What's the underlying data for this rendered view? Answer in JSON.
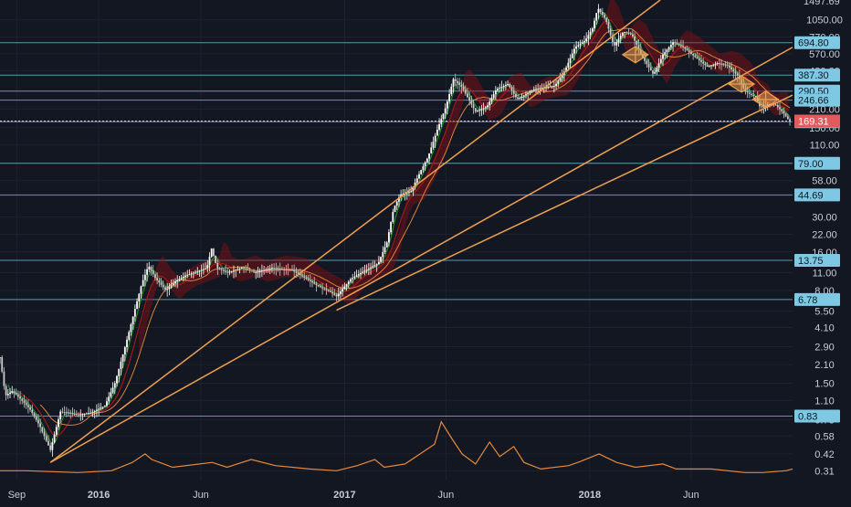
{
  "chart_data": {
    "type": "line",
    "scale": "log",
    "grid": true,
    "theme": {
      "background": "#131722",
      "grid": "#1e2230",
      "axis_text": "#c8ccd6",
      "level_line": "#5fb3c8",
      "trend": "#f0a050",
      "candle_up": "#ffffff",
      "candle_down": "#c9c9c9",
      "cloud": "#8b0f14",
      "ma_green": "#1f8a1f",
      "ma_red": "#a31717",
      "ma_orange": "#d8823a",
      "volume_line": "#e8893a",
      "last_price_bg": "#e05c5c",
      "label_bg": "#7ec8e3"
    },
    "y_ticks": [
      "1050.00",
      "770.00",
      "570.00",
      "420.00",
      "290.00",
      "210.00",
      "150.00",
      "110.00",
      "79.00",
      "58.00",
      "44.00",
      "30.00",
      "22.00",
      "16.00",
      "11.00",
      "8.00",
      "5.50",
      "4.10",
      "2.90",
      "2.10",
      "1.50",
      "1.10",
      "0.78",
      "0.58",
      "0.42",
      "0.31"
    ],
    "x_ticks": [
      "Sep",
      "2016",
      "Jun",
      "2017",
      "Jun",
      "2018",
      "Jun"
    ],
    "x_range": [
      "2015-08-07",
      "2018-10-30"
    ],
    "y_range": [
      0.26,
      1500
    ],
    "top_label": "1497.69",
    "horizontal_levels": [
      "694.80",
      "387.30",
      "290.50",
      "246.66",
      "167.22",
      "79.00",
      "44.69",
      "13.75",
      "6.78",
      "0.83"
    ],
    "last_price": "169.31",
    "trendlines": [
      {
        "from": [
          "2015-10-21",
          0.36
        ],
        "to": [
          "2018-04-16",
          1500
        ]
      },
      {
        "from": [
          "2015-10-21",
          0.36
        ],
        "to": [
          "2018-10-30",
          640
        ]
      },
      {
        "from": [
          "2016-12-20",
          5.6
        ],
        "to": [
          "2018-10-30",
          270
        ]
      }
    ],
    "price_series": [
      [
        "2015-08-07",
        2.4
      ],
      [
        "2015-08-15",
        1.2
      ],
      [
        "2015-08-25",
        1.3
      ],
      [
        "2015-09-05",
        1.15
      ],
      [
        "2015-09-20",
        0.95
      ],
      [
        "2015-10-05",
        0.7
      ],
      [
        "2015-10-21",
        0.45
      ],
      [
        "2015-11-05",
        0.9
      ],
      [
        "2015-12-01",
        0.85
      ],
      [
        "2015-12-20",
        0.88
      ],
      [
        "2016-01-10",
        1.0
      ],
      [
        "2016-01-25",
        1.5
      ],
      [
        "2016-02-10",
        3.0
      ],
      [
        "2016-02-25",
        6.0
      ],
      [
        "2016-03-05",
        9.0
      ],
      [
        "2016-03-15",
        12.5
      ],
      [
        "2016-03-25",
        10.0
      ],
      [
        "2016-04-10",
        8.0
      ],
      [
        "2016-04-25",
        9.5
      ],
      [
        "2016-05-10",
        10.5
      ],
      [
        "2016-06-10",
        12.0
      ],
      [
        "2016-06-17",
        17.0
      ],
      [
        "2016-06-25",
        12.0
      ],
      [
        "2016-07-10",
        11.0
      ],
      [
        "2016-08-01",
        12.0
      ],
      [
        "2016-08-20",
        11.0
      ],
      [
        "2016-09-15",
        12.0
      ],
      [
        "2016-10-15",
        11.5
      ],
      [
        "2016-11-10",
        9.5
      ],
      [
        "2016-11-25",
        8.5
      ],
      [
        "2016-12-10",
        7.8
      ],
      [
        "2016-12-20",
        7.2
      ],
      [
        "2017-01-10",
        9.8
      ],
      [
        "2017-02-01",
        11.5
      ],
      [
        "2017-02-20",
        13.0
      ],
      [
        "2017-03-05",
        19.0
      ],
      [
        "2017-03-15",
        35.0
      ],
      [
        "2017-03-25",
        45.0
      ],
      [
        "2017-04-10",
        48.0
      ],
      [
        "2017-04-25",
        70.0
      ],
      [
        "2017-05-05",
        88.0
      ],
      [
        "2017-05-20",
        150.0
      ],
      [
        "2017-06-01",
        220.0
      ],
      [
        "2017-06-12",
        360.0
      ],
      [
        "2017-06-25",
        310.0
      ],
      [
        "2017-07-15",
        200.0
      ],
      [
        "2017-08-01",
        220.0
      ],
      [
        "2017-08-15",
        300.0
      ],
      [
        "2017-09-01",
        330.0
      ],
      [
        "2017-09-15",
        250.0
      ],
      [
        "2017-10-10",
        300.0
      ],
      [
        "2017-11-10",
        320.0
      ],
      [
        "2017-11-25",
        420.0
      ],
      [
        "2017-12-10",
        640.0
      ],
      [
        "2017-12-25",
        720.0
      ],
      [
        "2018-01-05",
        900.0
      ],
      [
        "2018-01-13",
        1300.0
      ],
      [
        "2018-01-25",
        1050.0
      ],
      [
        "2018-02-06",
        650.0
      ],
      [
        "2018-02-20",
        850.0
      ],
      [
        "2018-03-05",
        800.0
      ],
      [
        "2018-03-20",
        540.0
      ],
      [
        "2018-04-06",
        390.0
      ],
      [
        "2018-04-20",
        560.0
      ],
      [
        "2018-05-05",
        700.0
      ],
      [
        "2018-05-20",
        640.0
      ],
      [
        "2018-06-10",
        520.0
      ],
      [
        "2018-06-25",
        450.0
      ],
      [
        "2018-07-10",
        480.0
      ],
      [
        "2018-07-25",
        460.0
      ],
      [
        "2018-08-10",
        380.0
      ],
      [
        "2018-08-20",
        290.0
      ],
      [
        "2018-09-05",
        260.0
      ],
      [
        "2018-09-12",
        215.0
      ],
      [
        "2018-09-25",
        230.0
      ],
      [
        "2018-10-05",
        225.0
      ],
      [
        "2018-10-15",
        200.0
      ],
      [
        "2018-10-25",
        169.31
      ]
    ],
    "volume_series": [
      [
        "2015-08-07",
        0.31
      ],
      [
        "2015-09-15",
        0.31
      ],
      [
        "2015-12-01",
        0.3
      ],
      [
        "2016-01-20",
        0.31
      ],
      [
        "2016-02-20",
        0.36
      ],
      [
        "2016-03-10",
        0.42
      ],
      [
        "2016-03-20",
        0.38
      ],
      [
        "2016-04-20",
        0.33
      ],
      [
        "2016-06-18",
        0.36
      ],
      [
        "2016-07-10",
        0.33
      ],
      [
        "2016-08-15",
        0.38
      ],
      [
        "2016-09-20",
        0.34
      ],
      [
        "2016-11-10",
        0.32
      ],
      [
        "2016-12-20",
        0.31
      ],
      [
        "2017-01-20",
        0.34
      ],
      [
        "2017-02-15",
        0.38
      ],
      [
        "2017-03-01",
        0.33
      ],
      [
        "2017-04-01",
        0.35
      ],
      [
        "2017-05-15",
        0.5
      ],
      [
        "2017-05-25",
        0.75
      ],
      [
        "2017-06-10",
        0.55
      ],
      [
        "2017-06-25",
        0.42
      ],
      [
        "2017-07-15",
        0.35
      ],
      [
        "2017-08-05",
        0.52
      ],
      [
        "2017-08-20",
        0.4
      ],
      [
        "2017-09-10",
        0.48
      ],
      [
        "2017-09-25",
        0.36
      ],
      [
        "2017-10-20",
        0.32
      ],
      [
        "2017-12-01",
        0.34
      ],
      [
        "2017-12-20",
        0.37
      ],
      [
        "2018-01-15",
        0.42
      ],
      [
        "2018-02-10",
        0.36
      ],
      [
        "2018-03-10",
        0.33
      ],
      [
        "2018-04-20",
        0.35
      ],
      [
        "2018-05-10",
        0.32
      ],
      [
        "2018-07-01",
        0.32
      ],
      [
        "2018-08-20",
        0.3
      ],
      [
        "2018-09-15",
        0.3
      ],
      [
        "2018-10-20",
        0.31
      ],
      [
        "2018-10-30",
        0.32
      ]
    ]
  }
}
